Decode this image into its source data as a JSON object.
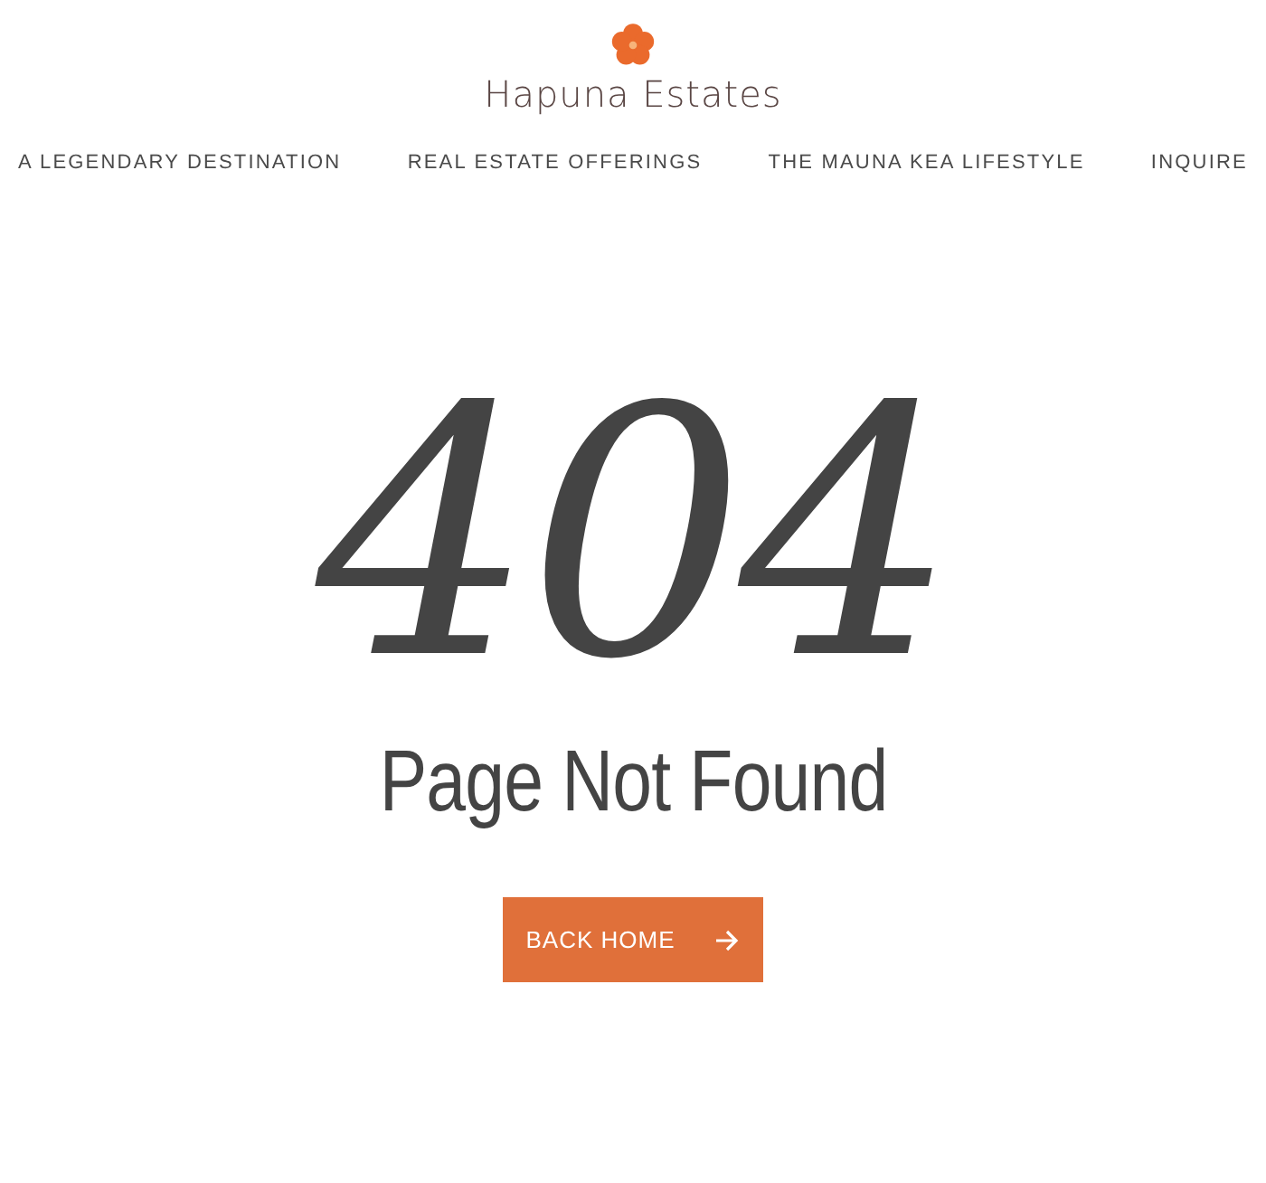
{
  "logo": {
    "text": "Hapuna Estates"
  },
  "nav": [
    {
      "label": "A LEGENDARY DESTINATION"
    },
    {
      "label": "REAL ESTATE OFFERINGS"
    },
    {
      "label": "THE MAUNA KEA LIFESTYLE"
    },
    {
      "label": "INQUIRE"
    }
  ],
  "error": {
    "code": "404",
    "message": "Page Not Found"
  },
  "button": {
    "label": "BACK HOME"
  }
}
